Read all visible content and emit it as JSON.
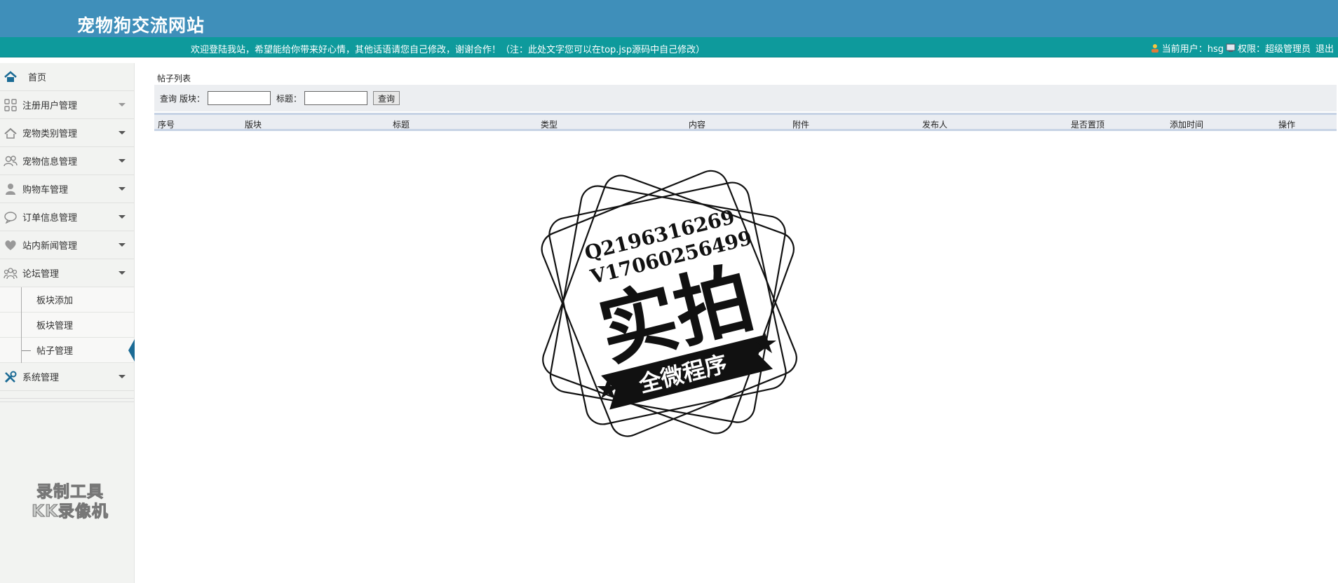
{
  "header": {
    "site_title": "宠物狗交流网站",
    "welcome_text": "欢迎登陆我站，希望能给你带来好心情，其他话语请您自己修改，谢谢合作！（注：此处文字您可以在top.jsp源码中自己修改）",
    "current_user_label": "当前用户：hsg",
    "permission_label": "权限：超级管理员",
    "logout_label": "退出"
  },
  "sidebar": {
    "items": [
      {
        "label": "首页",
        "icon": "home-icon"
      },
      {
        "label": "注册用户管理",
        "icon": "grid-icon"
      },
      {
        "label": "宠物类别管理",
        "icon": "house-icon"
      },
      {
        "label": "宠物信息管理",
        "icon": "users-icon"
      },
      {
        "label": "购物车管理",
        "icon": "person-icon"
      },
      {
        "label": "订单信息管理",
        "icon": "chat-icon"
      },
      {
        "label": "站内新闻管理",
        "icon": "heart-icon"
      },
      {
        "label": "论坛管理",
        "icon": "group-icon"
      }
    ],
    "forum_subitems": [
      "板块添加",
      "板块管理",
      "帖子管理"
    ],
    "system_item": {
      "label": "系统管理",
      "icon": "tools-icon"
    },
    "watermark_line1": "录制工具",
    "watermark_line2": "KK录像机"
  },
  "main": {
    "page_title": "帖子列表",
    "search": {
      "query_label": "查询",
      "board_label": "版块：",
      "title_label": "标题：",
      "board_value": "",
      "title_value": "",
      "button_label": "查询"
    },
    "table": {
      "columns": [
        "序号",
        "版块",
        "标题",
        "类型",
        "内容",
        "附件",
        "发布人",
        "是否置顶",
        "添加时间",
        "操作"
      ],
      "rows": []
    }
  },
  "stamp": {
    "line1": "Q2196316269",
    "line2": "V17060256499",
    "big_text": "实拍",
    "ribbon_text": "全微程序"
  }
}
